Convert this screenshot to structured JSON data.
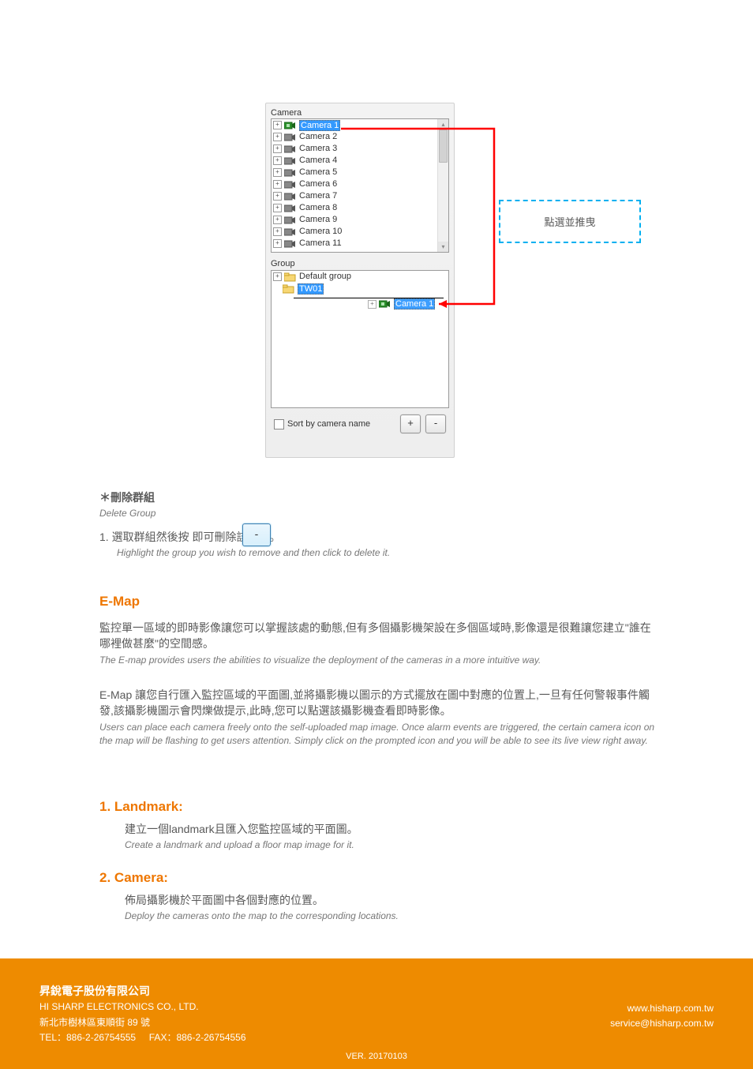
{
  "callout": "點選並推曳",
  "panel": {
    "camera_label": "Camera",
    "group_label": "Group",
    "cameras": [
      "Camera 1",
      "Camera 2",
      "Camera 3",
      "Camera 4",
      "Camera 5",
      "Camera 6",
      "Camera 7",
      "Camera 8",
      "Camera 9",
      "Camera 10",
      "Camera 11"
    ],
    "default_group": "Default group",
    "sub_group": "TW01",
    "drag_label": "Camera 1",
    "sort_label": "Sort by camera name",
    "plus": "+",
    "minus": "-"
  },
  "minus_btn": "-",
  "sec_delete": {
    "title_zh": "＊刪除群組",
    "title_en": "Delete Group",
    "step_zh": "1.  選取群組然後按        即可刪除該群組。",
    "step_en": "Highlight the group you wish to remove and then click            to delete it."
  },
  "sec_emap": {
    "title_zh": "E-Map",
    "body1_zh": "監控單一區域的即時影像讓您可以掌握該處的動態,但有多個攝影機架設在多個區域時,影像還是很難讓您建立\"誰在哪裡做甚麼\"的空間感。",
    "body1_en": "The E-map provides users the abilities to visualize the deployment of the cameras in a more intuitive way.",
    "body2_zh": "E-Map 讓您自行匯入監控區域的平面圖,並將攝影機以圖示的方式擺放在圖中對應的位置上,一旦有任何警報事件觸發,該攝影機圖示會閃爍做提示,此時,您可以點選該攝影機查看即時影像。",
    "body2_en": "Users can place each camera freely onto the self-uploaded map image. Once alarm events are triggered, the certain camera icon on the map will be flashing to get users attention. Simply click on the prompted icon and you will be able to see its live view right away."
  },
  "sec_landmark": {
    "num": "1.",
    "title_zh": "Landmark:",
    "body_zh": "建立一個landmark且匯入您監控區域的平面圖。",
    "body_en": "Create a landmark and upload a floor map image for it."
  },
  "sec_camera": {
    "num": "2.",
    "title_zh": "Camera:",
    "body_zh": "佈局攝影機於平面圖中各個對應的位置。",
    "body_en": "Deploy the cameras onto the map to the corresponding locations."
  },
  "footer": {
    "company": "昇銳電子股份有限公司",
    "company_en": "HI SHARP ELECTRONICS CO., LTD.",
    "addr": "新北市樹林區東順街 89 號",
    "tel": "TEL：886-2-26754555",
    "fax": "FAX：886-2-26754556",
    "site": "www.hisharp.com.tw",
    "email": "service@hisharp.com.tw",
    "version": "VER. 20170103"
  }
}
